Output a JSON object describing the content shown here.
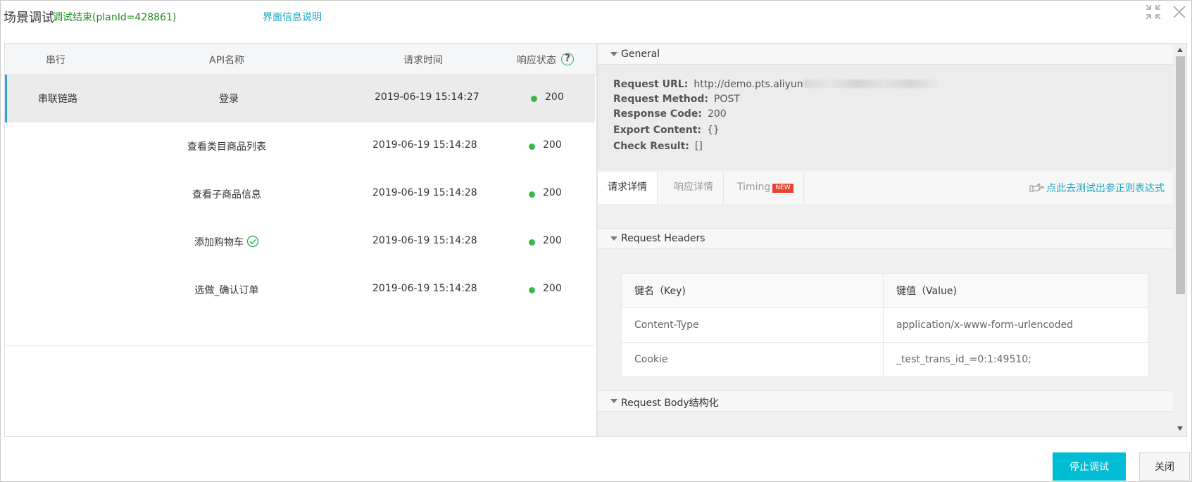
{
  "title": {
    "main": "场景调试",
    "status": "调试结束(planId=428861)",
    "help_link": "界面信息说明"
  },
  "left_table": {
    "headers": {
      "serial": "串行",
      "api_name": "API名称",
      "request_time": "请求时间",
      "response_status": "响应状态"
    },
    "rows": [
      {
        "serial": "串联链路",
        "api_name": "登录",
        "time": "2019-06-19 15:14:27",
        "code": "200",
        "selected": true
      },
      {
        "serial": "",
        "api_name": "查看类目商品列表",
        "time": "2019-06-19 15:14:28",
        "code": "200"
      },
      {
        "serial": "",
        "api_name": "查看子商品信息",
        "time": "2019-06-19 15:14:28",
        "code": "200"
      },
      {
        "serial": "",
        "api_name": "添加购物车",
        "time": "2019-06-19 15:14:28",
        "code": "200",
        "check_icon": true
      },
      {
        "serial": "",
        "api_name": "选做_确认订单",
        "time": "2019-06-19 15:14:28",
        "code": "200"
      }
    ],
    "status_dot_color": "#3cb64a"
  },
  "general": {
    "section_title": "General",
    "request_url_label": "Request URL:",
    "request_url_value": "http://demo.pts.aliyun",
    "request_method_label": "Request Method:",
    "request_method_value": "POST",
    "response_code_label": "Response Code:",
    "response_code_value": "200",
    "export_content_label": "Export Content:",
    "export_content_value": "{}",
    "check_result_label": "Check Result:",
    "check_result_value": "[]"
  },
  "tabs": {
    "request_detail": "请求详情",
    "response_detail": "响应详情",
    "timing": "Timing",
    "new_badge": "NEW",
    "regex_link": "点此去测试出参正则表达式"
  },
  "request_headers": {
    "section_title": "Request Headers",
    "key_header": "键名（Key)",
    "value_header": "键值（Value)",
    "rows": [
      {
        "key": "Content-Type",
        "value": "application/x-www-form-urlencoded"
      },
      {
        "key": "Cookie",
        "value": "_test_trans_id_=0:1:49510;"
      }
    ]
  },
  "request_body": {
    "section_title": "Request Body结构化"
  },
  "footer": {
    "stop_button": "停止调试",
    "close_button": "关闭"
  },
  "colors": {
    "accent": "#00bcd4",
    "link": "#1aa6c4",
    "status_green": "#1f8a1f"
  },
  "icons": [
    "collapse-icon",
    "close-icon",
    "help-icon",
    "check-circle-icon",
    "hand-pointer-icon",
    "triangle-down-icon"
  ]
}
